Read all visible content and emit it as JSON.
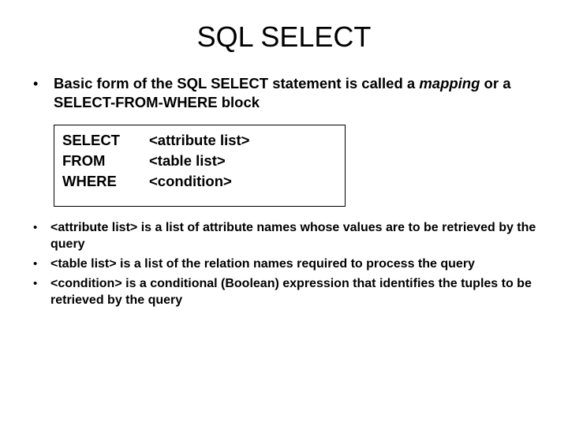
{
  "title": "SQL SELECT",
  "intro": {
    "line1_pre": "Basic form of the SQL SELECT statement is called a ",
    "mapping_word": "mapping",
    "line1_mid": " or a ",
    "sfw_block": "SELECT-FROM-WHERE block"
  },
  "syntax": {
    "rows": [
      {
        "keyword": "SELECT",
        "placeholder": "<attribute list>"
      },
      {
        "keyword": "FROM",
        "placeholder": "<table list>"
      },
      {
        "keyword": "WHERE",
        "placeholder": "<condition>"
      }
    ]
  },
  "defs": [
    "<attribute list> is a list of attribute names whose values are to be retrieved by the query",
    "<table list> is a list of the relation names required to process the query",
    "<condition> is a conditional (Boolean) expression that identifies the tuples to be retrieved by the query"
  ]
}
